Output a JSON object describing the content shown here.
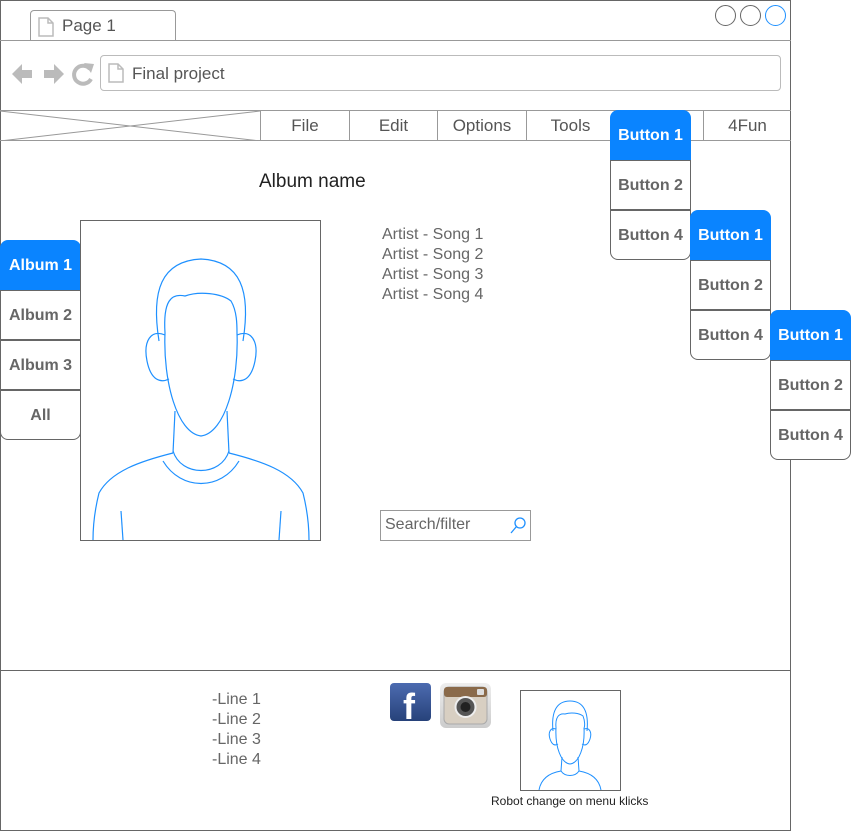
{
  "browser": {
    "tab_title": "Page 1",
    "address": "Final project"
  },
  "menu": {
    "items": [
      "File",
      "Edit",
      "Options",
      "Tools",
      "4Fun"
    ]
  },
  "dropdowns": [
    {
      "buttons": [
        "Button 1",
        "Button 2",
        "Button 4"
      ],
      "active_index": 0
    },
    {
      "buttons": [
        "Button 1",
        "Button 2",
        "Button 4"
      ],
      "active_index": 0
    },
    {
      "buttons": [
        "Button 1",
        "Button 2",
        "Button 4"
      ],
      "active_index": 0
    }
  ],
  "albums": {
    "items": [
      "Album 1",
      "Album 2",
      "Album 3",
      "All"
    ],
    "active_index": 0
  },
  "main": {
    "album_title": "Album name",
    "songs": [
      "Artist - Song 1",
      "Artist - Song 2",
      "Artist - Song 3",
      "Artist - Song 4"
    ],
    "search_placeholder": "Search/filter"
  },
  "footer": {
    "lines": [
      "-Line 1",
      "-Line 2",
      "-Line 3",
      "-Line 4"
    ],
    "social_icons": [
      "facebook-icon",
      "instagram-icon"
    ],
    "robot_caption": "Robot change on menu klicks"
  },
  "colors": {
    "accent": "#0a84ff",
    "sketch_line": "#1e90ff"
  }
}
